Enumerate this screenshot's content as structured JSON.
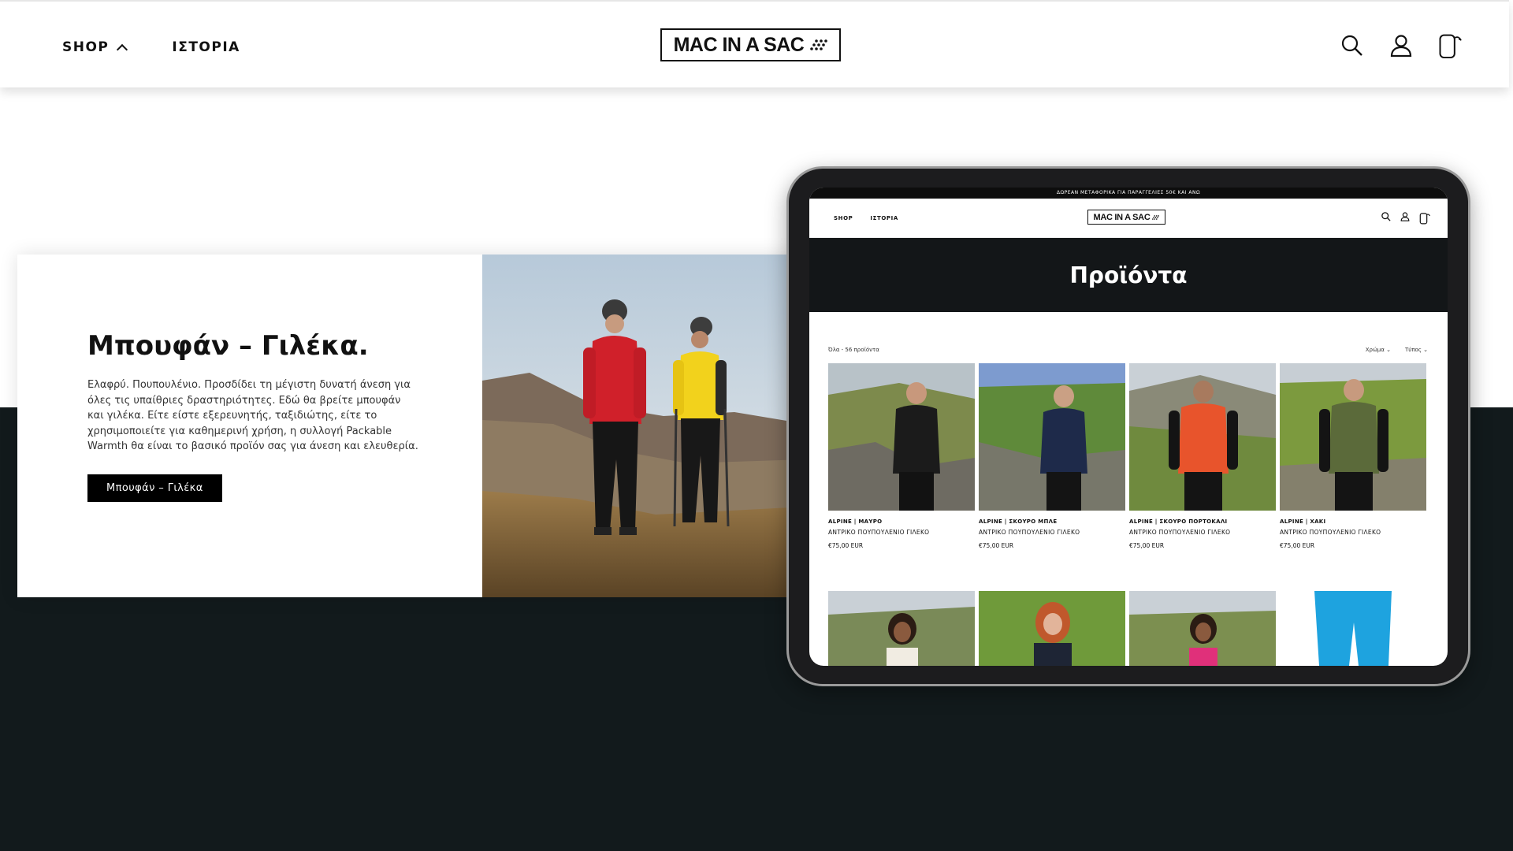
{
  "header": {
    "nav": [
      {
        "label": "SHOP"
      },
      {
        "label": "ΙΣΤΟΡΙΑ"
      }
    ],
    "logo_text": "MAC IN A SAC"
  },
  "promo": {
    "title": "Μπουφάν – Γιλέκα.",
    "description": "Ελαφρύ. Πουπουλένιο. Προσδίδει τη μέγιστη δυνατή άνεση για όλες τις υπαίθριες δραστηριότητες.  Εδώ θα βρείτε μπουφάν και γιλέκα. Είτε είστε εξερευνητής, ταξιδιώτης, είτε το χρησιμοποιείτε για καθημερινή χρήση, η συλλογή Packable Warmth θα είναι το βασικό προϊόν σας για άνεση και ελευθερία.",
    "button_label": "Μπουφάν – Γιλέκα"
  },
  "tablet": {
    "announcement": "ΔΩΡΕΑΝ ΜΕΤΑΦΟΡΙΚΑ ΓΙΑ ΠΑΡΑΓΓΕΛΙΕΣ 50€ ΚΑΙ ΑΝΩ",
    "nav": [
      {
        "label": "SHOP"
      },
      {
        "label": "ΙΣΤΟΡΙΑ"
      }
    ],
    "logo_text": "MAC IN A SAC",
    "banner_title": "Προϊόντα",
    "filter_left": "Όλα -  56 προϊόντα",
    "filter_color": "Χρώμα",
    "filter_type": "Τύπος",
    "products": [
      {
        "name": "ALPINE | ΜΑΥΡΟ",
        "type": "ΑΝΤΡΙΚΟ ΠΟΥΠΟΥΛΕΝΙΟ ΓΙΛΕΚΟ",
        "price": "€75,00 EUR"
      },
      {
        "name": "ALPINE | ΣΚΟΥΡΟ ΜΠΛΕ",
        "type": "ΑΝΤΡΙΚΟ ΠΟΥΠΟΥΛΕΝΙΟ ΓΙΛΕΚΟ",
        "price": "€75,00 EUR"
      },
      {
        "name": "ALPINE | ΣΚΟΥΡΟ ΠΟΡΤΟΚΑΛΙ",
        "type": "ΑΝΤΡΙΚΟ ΠΟΥΠΟΥΛΕΝΙΟ ΓΙΛΕΚΟ",
        "price": "€75,00 EUR"
      },
      {
        "name": "ALPINE | ΧΑΚΙ",
        "type": "ΑΝΤΡΙΚΟ ΠΟΥΠΟΥΛΕΝΙΟ ΓΙΛΕΚΟ",
        "price": "€75,00 EUR"
      }
    ]
  },
  "colors": {
    "dark_band": "#121a1c",
    "banner": "#131618",
    "vest_black": "#1b1b1b",
    "vest_navy": "#1e2a4a",
    "vest_orange": "#e8542c",
    "vest_khaki": "#5b6a3a"
  }
}
